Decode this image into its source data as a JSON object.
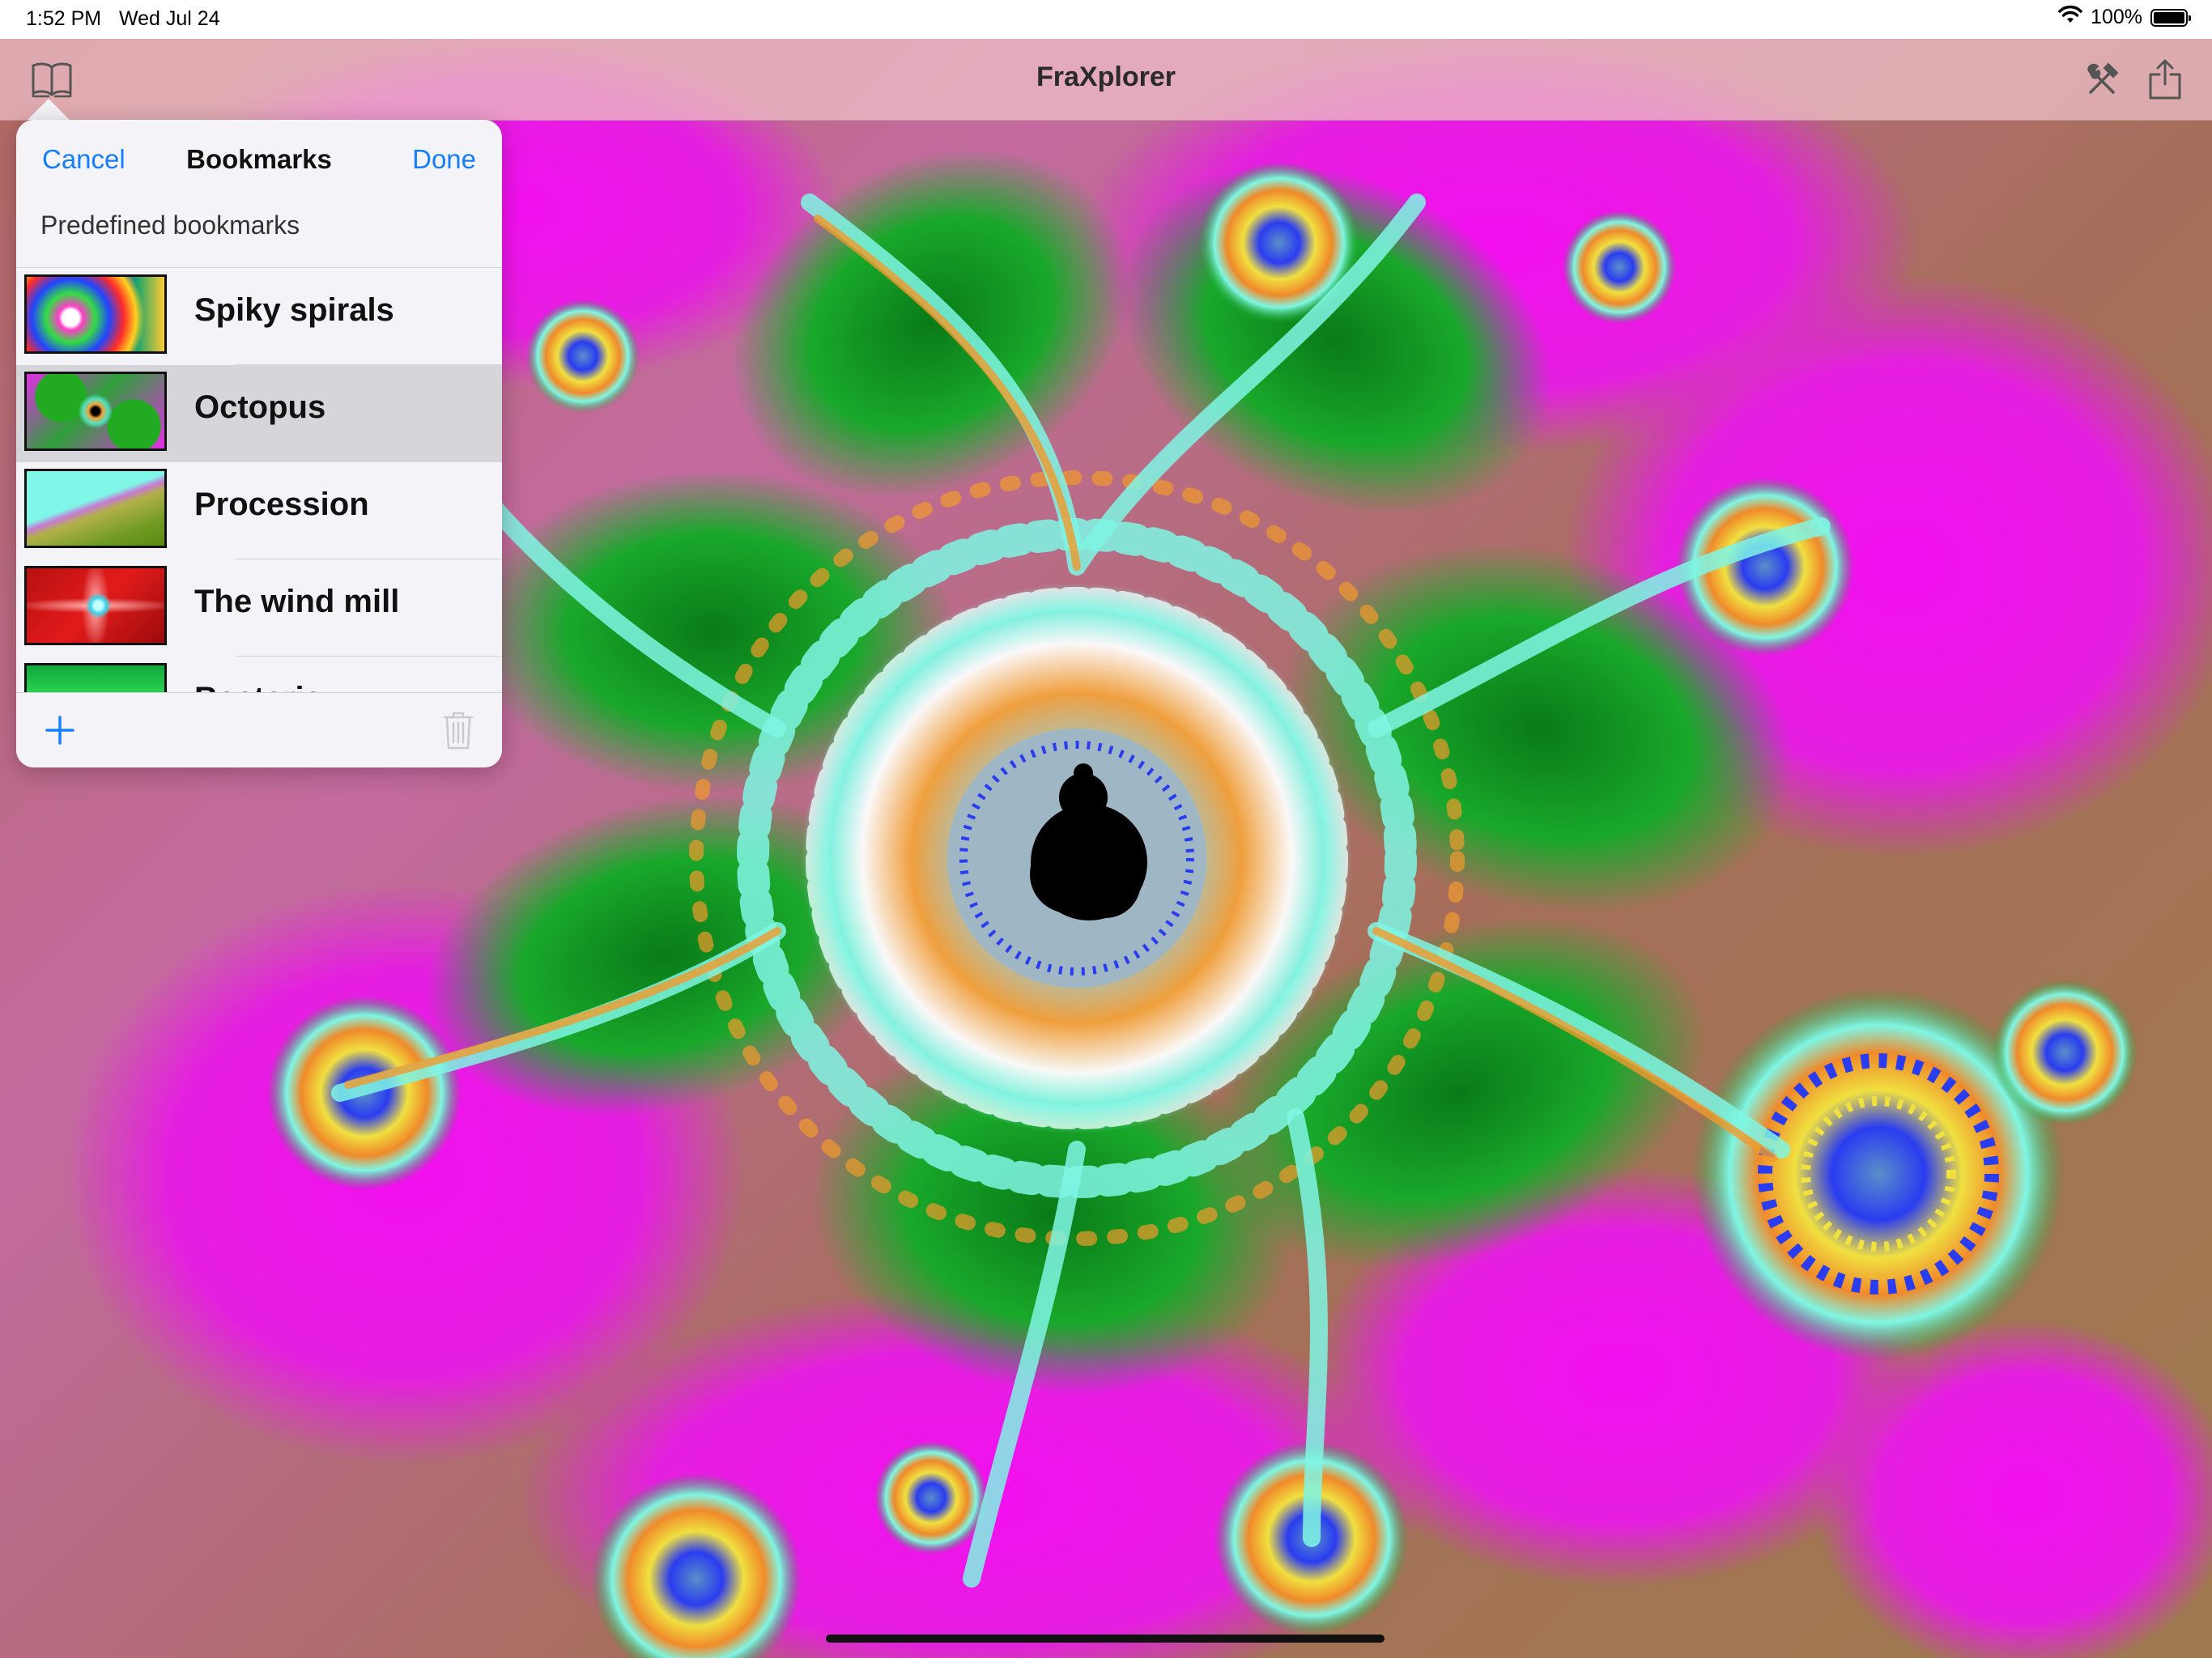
{
  "status_bar": {
    "time": "1:52 PM",
    "date": "Wed Jul 24",
    "battery": "100%"
  },
  "nav_bar": {
    "title": "FraXplorer",
    "left_icon": "book-icon",
    "right_icons": [
      "tools-icon",
      "share-icon"
    ]
  },
  "bookmarks_popover": {
    "cancel_label": "Cancel",
    "title": "Bookmarks",
    "done_label": "Done",
    "section_header": "Predefined bookmarks",
    "items": [
      {
        "label": "Spiky spirals",
        "selected": false
      },
      {
        "label": "Octopus",
        "selected": true
      },
      {
        "label": "Procession",
        "selected": false
      },
      {
        "label": "The wind mill",
        "selected": false
      },
      {
        "label": "Bacteria",
        "selected": false
      }
    ],
    "toolbar": {
      "add_icon": "plus-icon",
      "delete_icon": "trash-icon"
    }
  },
  "colors": {
    "accent": "#157efb",
    "selected_row": "#d6d6da",
    "popover_bg": "#f4f4f8",
    "fractal_magenta": "#e51fe0",
    "fractal_green": "#15a024",
    "fractal_cyan": "#7ff6e4",
    "fractal_orange": "#f19a2c"
  }
}
